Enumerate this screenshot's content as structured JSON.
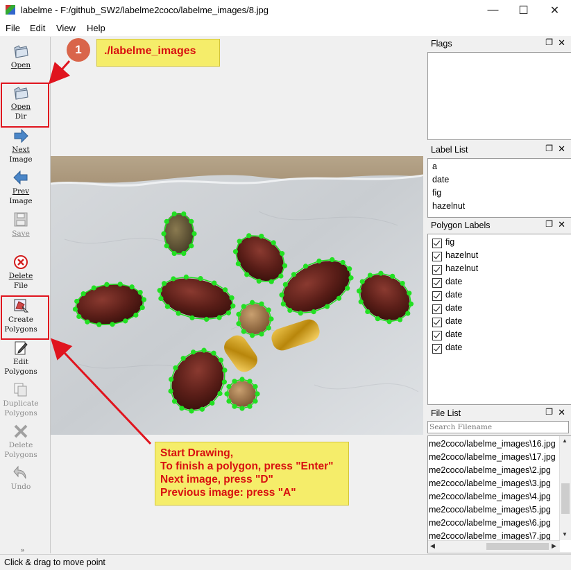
{
  "window": {
    "title": "labelme - F:/github_SW2/labelme2coco/labelme_images/8.jpg",
    "minimize_icon": "minimize-icon",
    "maximize_icon": "maximize-icon",
    "close_icon": "close-icon"
  },
  "menu": [
    "File",
    "Edit",
    "View",
    "Help"
  ],
  "toolbar": {
    "open": "Open",
    "open_dir_1": "Open",
    "open_dir_2": "Dir",
    "next_1": "Next",
    "next_2": "Image",
    "prev_1": "Prev",
    "prev_2": "Image",
    "save": "Save",
    "delete_1": "Delete",
    "delete_2": "File",
    "create_1": "Create",
    "create_2": "Polygons",
    "edit_1": "Edit",
    "edit_2": "Polygons",
    "dup_1": "Duplicate",
    "dup_2": "Polygons",
    "del_poly_1": "Delete",
    "del_poly_2": "Polygons",
    "undo": "Undo"
  },
  "annotations": {
    "badge": "1",
    "callout_top": "./labelme_images",
    "callout_bottom": [
      "Start Drawing,",
      "To finish a polygon, press \"Enter\"",
      "Next image, press \"D\"",
      "Previous image: press \"A\""
    ],
    "highlight_color": "#e0141e",
    "callout_bg": "#f5ed6a",
    "polygon_color": "#22e022"
  },
  "docks": {
    "flags": {
      "title": "Flags"
    },
    "label_list": {
      "title": "Label List",
      "items": [
        "a",
        "date",
        "fig",
        "hazelnut"
      ]
    },
    "polygon_labels": {
      "title": "Polygon Labels",
      "items": [
        "fig",
        "hazelnut",
        "hazelnut",
        "date",
        "date",
        "date",
        "date",
        "date",
        "date"
      ],
      "checked": true
    },
    "file_list": {
      "title": "File List",
      "search_placeholder": "Search Filename",
      "files": [
        "me2coco/labelme_images\\16.jpg",
        "me2coco/labelme_images\\17.jpg",
        "me2coco/labelme_images\\2.jpg",
        "me2coco/labelme_images\\3.jpg",
        "me2coco/labelme_images\\4.jpg",
        "me2coco/labelme_images\\5.jpg",
        "me2coco/labelme_images\\6.jpg",
        "me2coco/labelme_images\\7.jpg"
      ]
    },
    "float_icon": "float-icon",
    "close_icon": "close-icon"
  },
  "status": "Click & drag to move point"
}
